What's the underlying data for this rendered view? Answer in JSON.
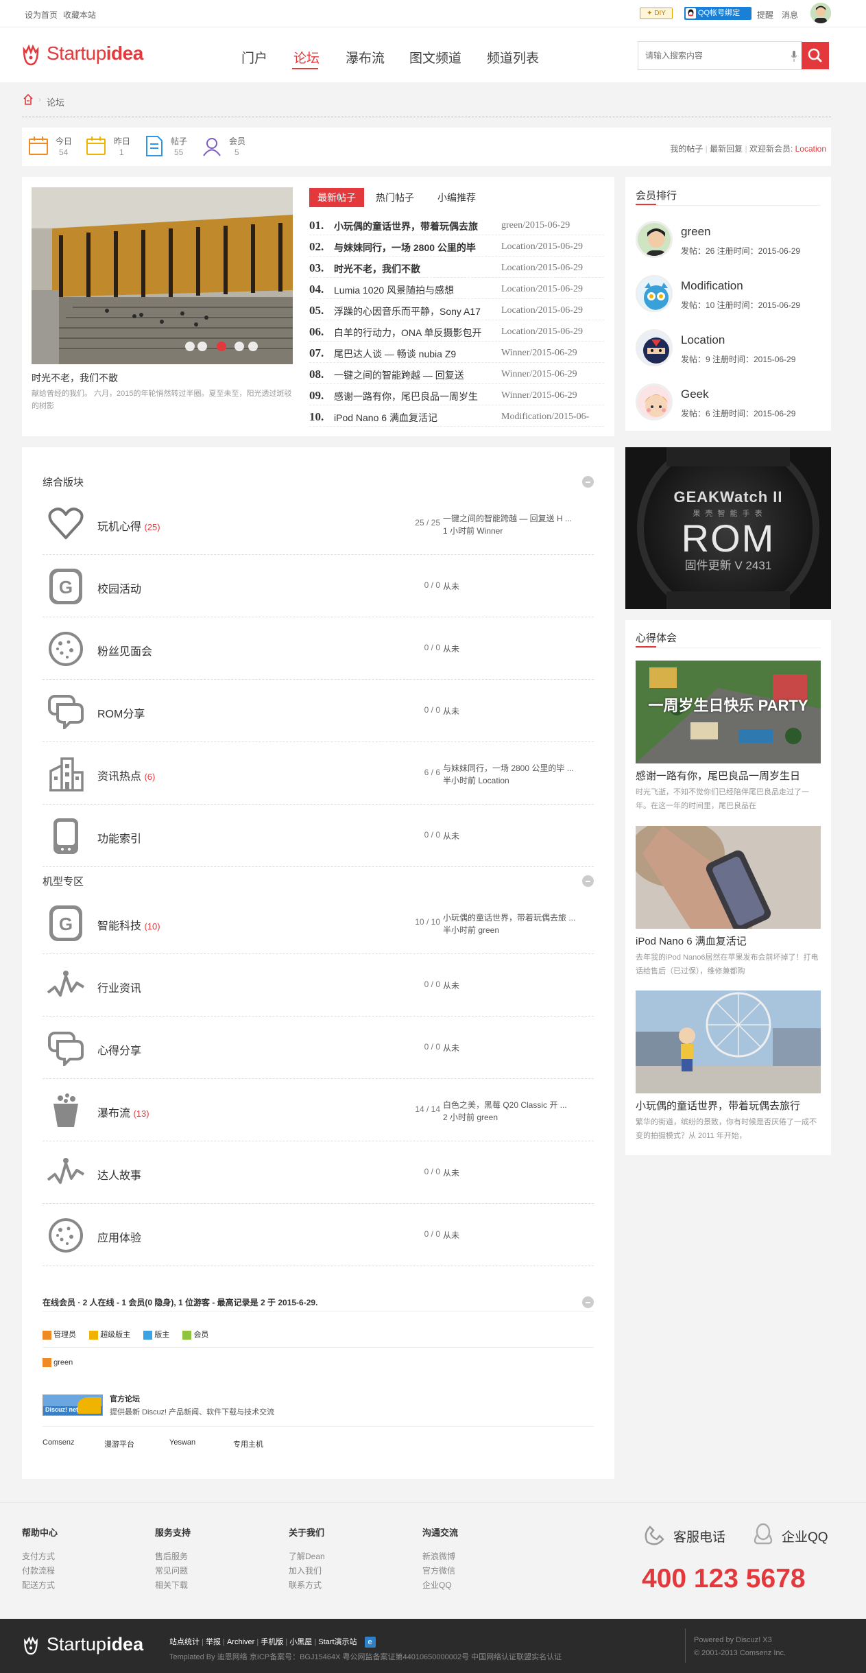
{
  "topbar": {
    "set_home": "设为首页",
    "bookmark": "收藏本站",
    "diy": "DIY",
    "qq_bind": "QQ帐号绑定",
    "remind": "提醒",
    "message": "消息"
  },
  "header": {
    "logo_a": "Startup",
    "logo_b": "idea",
    "nav": [
      "门户",
      "论坛",
      "瀑布流",
      "图文频道",
      "频道列表"
    ],
    "active_nav": "论坛",
    "search_placeholder": "请输入搜索内容"
  },
  "breadcrumb": {
    "current": "论坛"
  },
  "stats": {
    "items": [
      {
        "label": "今日",
        "value": "54"
      },
      {
        "label": "昨日",
        "value": "1"
      },
      {
        "label": "帖子",
        "value": "55"
      },
      {
        "label": "会员",
        "value": "5"
      }
    ],
    "my_posts": "我的帖子",
    "latest_reply": "最新回复",
    "welcome_prefix": "欢迎新会员:",
    "welcome_name": "Location"
  },
  "slider": {
    "caption_title": "时光不老，我们不散",
    "caption_desc": "献给曾经的我们。 六月，2015的年轮悄然转过半圈。夏至未至，阳光透过斑驳的树影"
  },
  "post_tabs": [
    "最新帖子",
    "热门帖子",
    "小编推荐"
  ],
  "posts": [
    {
      "num": "01.",
      "title": "小玩偶的童话世界，带着玩偶去旅",
      "author": "green/2015-06-29",
      "bold": true
    },
    {
      "num": "02.",
      "title": "与妹妹同行，一场 2800 公里的毕",
      "author": "Location/2015-06-29",
      "bold": true
    },
    {
      "num": "03.",
      "title": "时光不老，我们不散",
      "author": "Location/2015-06-29",
      "bold": true
    },
    {
      "num": "04.",
      "title": "Lumia 1020 风景随拍与感想",
      "author": "Location/2015-06-29",
      "bold": false
    },
    {
      "num": "05.",
      "title": "浮躁的心因音乐而平静，Sony A17",
      "author": "Location/2015-06-29",
      "bold": false
    },
    {
      "num": "06.",
      "title": "白羊的行动力，ONA 单反摄影包开",
      "author": "Location/2015-06-29",
      "bold": false
    },
    {
      "num": "07.",
      "title": "尾巴达人谈 — 畅谈 nubia Z9",
      "author": "Winner/2015-06-29",
      "bold": false
    },
    {
      "num": "08.",
      "title": "一键之间的智能跨越 — 回复送",
      "author": "Winner/2015-06-29",
      "bold": false
    },
    {
      "num": "09.",
      "title": "感谢一路有你，尾巴良品一周岁生",
      "author": "Winner/2015-06-29",
      "bold": false
    },
    {
      "num": "10.",
      "title": "iPod Nano 6 满血复活记",
      "author": "Modification/2015-06-",
      "bold": false
    }
  ],
  "member_rank": {
    "title": "会员排行",
    "members": [
      {
        "name": "green",
        "info": "发帖：26  注册时间：2015-06-29"
      },
      {
        "name": "Modification",
        "info": "发帖：10  注册时间：2015-06-29"
      },
      {
        "name": "Location",
        "info": "发帖：9  注册时间：2015-06-29"
      },
      {
        "name": "Geek",
        "info": "发帖：6  注册时间：2015-06-29"
      }
    ]
  },
  "ad": {
    "line1": "GEAKWatch II",
    "line2": "果 壳 智 能 手 表",
    "line3": "ROM",
    "line4": "固件更新 V 2431"
  },
  "sections": [
    {
      "title": "综合版块",
      "forums": [
        {
          "name": "玩机心得",
          "count": "(25)",
          "stat": "25 / 25",
          "last1": "一键之间的智能跨越 — 回复送 H ...",
          "last2": "1 小时前 Winner",
          "icon": "heart-icon"
        },
        {
          "name": "校园活动",
          "count": "",
          "stat": "0 / 0",
          "last1": "从未",
          "last2": "",
          "icon": "g-badge-icon"
        },
        {
          "name": "粉丝见面会",
          "count": "",
          "stat": "0 / 0",
          "last1": "从未",
          "last2": "",
          "icon": "cookie-icon"
        },
        {
          "name": "ROM分享",
          "count": "",
          "stat": "0 / 0",
          "last1": "从未",
          "last2": "",
          "icon": "chat-bubbles-icon"
        },
        {
          "name": "资讯热点",
          "count": "(6)",
          "stat": "6 / 6",
          "last1": "与妹妹同行，一场 2800 公里的毕 ...",
          "last2": "半小时前 Location",
          "icon": "building-icon"
        },
        {
          "name": "功能索引",
          "count": "",
          "stat": "0 / 0",
          "last1": "从未",
          "last2": "",
          "icon": "device-icon"
        }
      ]
    },
    {
      "title": "机型专区",
      "forums": [
        {
          "name": "智能科技",
          "count": "(10)",
          "stat": "10 / 10",
          "last1": "小玩偶的童话世界，带着玩偶去旅 ...",
          "last2": "半小时前 green",
          "icon": "g-badge-icon"
        },
        {
          "name": "行业资讯",
          "count": "",
          "stat": "0 / 0",
          "last1": "从未",
          "last2": "",
          "icon": "wave-icon"
        },
        {
          "name": "心得分享",
          "count": "",
          "stat": "0 / 0",
          "last1": "从未",
          "last2": "",
          "icon": "chat-bubbles-icon"
        },
        {
          "name": "瀑布流",
          "count": "(13)",
          "stat": "14 / 14",
          "last1": "白色之美，黑莓 Q20 Classic 开 ...",
          "last2": "2 小时前 green",
          "icon": "cup-icon"
        },
        {
          "name": "达人故事",
          "count": "",
          "stat": "0 / 0",
          "last1": "从未",
          "last2": "",
          "icon": "wave-icon"
        },
        {
          "name": "应用体验",
          "count": "",
          "stat": "0 / 0",
          "last1": "从未",
          "last2": "",
          "icon": "cookie-icon"
        }
      ]
    }
  ],
  "online": {
    "summary": "在线会员 · 2 人在线 - 1 会员(0 隐身), 1 位游客 - 最高记录是 2 于 2015-6-29.",
    "legend": [
      "管理员",
      "超级版主",
      "版主",
      "会员"
    ],
    "users": [
      "green"
    ]
  },
  "official": {
    "logo_text": "Discuz! net",
    "title": "官方论坛",
    "desc": "提供最新 Discuz! 产品新闻、软件下载与技术交流"
  },
  "friend_links": [
    "Comsenz",
    "漫游平台",
    "Yeswan",
    "专用主机"
  ],
  "experience": {
    "title": "心得体会",
    "items": [
      {
        "title": "感谢一路有你，尾巴良品一周岁生日",
        "desc": "时光飞逝，不知不觉你们已经陪伴尾巴良品走过了一年。在这一年的时间里，尾巴良品在",
        "img_text": "一周岁生日快乐 PARTY"
      },
      {
        "title": "iPod Nano 6 满血复活记",
        "desc": "去年我的iPod Nano6居然在苹果发布会前坏掉了！打电话给售后（已过保），维修兼都购"
      },
      {
        "title": "小玩偶的童话世界，带着玩偶去旅行",
        "desc": "繁华的街道，缤纷的景致，你有时候是否厌倦了一成不变的拍摄模式？从 2011 年开始，"
      }
    ]
  },
  "footer": {
    "cols": [
      {
        "title": "帮助中心",
        "links": [
          "支付方式",
          "付款流程",
          "配送方式"
        ]
      },
      {
        "title": "服务支持",
        "links": [
          "售后服务",
          "常见问题",
          "相关下载"
        ]
      },
      {
        "title": "关于我们",
        "links": [
          "了解Dean",
          "加入我们",
          "联系方式"
        ]
      },
      {
        "title": "沟通交流",
        "links": [
          "新浪微博",
          "官方微信",
          "企业QQ"
        ]
      }
    ],
    "service_phone_label": "客服电话",
    "enterprise_qq": "企业QQ",
    "phone": "400 123 5678"
  },
  "bottom": {
    "links": [
      "站点统计",
      "举报",
      "Archiver",
      "手机版",
      "小黑屋",
      "Start演示站"
    ],
    "copyright": "Templated By 迪恩网络  京ICP备案号：BGJ15464X   粤公网监备案证第44010650000002号   中国网络认证联盟实名认证",
    "powered": "Powered by Discuz! X3",
    "comsenz": "© 2001-2013 Comsenz Inc."
  },
  "colors": {
    "accent": "#e4393c",
    "bg": "#f3f3f3",
    "dark_footer": "#2b2b2b"
  }
}
